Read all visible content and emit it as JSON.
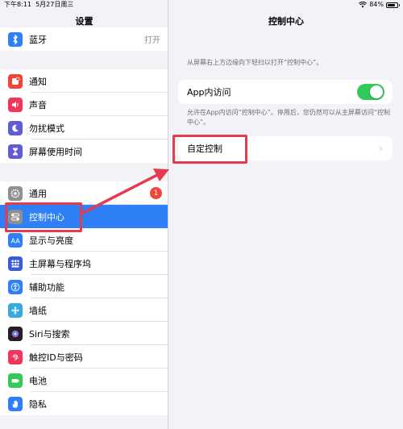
{
  "status": {
    "time": "下午8:11",
    "date": "5月27日周三",
    "battery": "84%",
    "battery_level": 0.84
  },
  "sidebar": {
    "title": "设置",
    "groups": [
      [
        {
          "label": "蓝牙",
          "value": "打开",
          "icon": "bluetooth-icon",
          "color": "#2f7ff6"
        }
      ],
      [
        {
          "label": "通知",
          "icon": "notification-icon",
          "color": "#f0463a"
        },
        {
          "label": "声音",
          "icon": "speaker-icon",
          "color": "#f0365a"
        },
        {
          "label": "勿扰模式",
          "icon": "moon-icon",
          "color": "#5f5cd6"
        },
        {
          "label": "屏幕使用时间",
          "icon": "hourglass-icon",
          "color": "#5f5cd6"
        }
      ],
      [
        {
          "label": "通用",
          "badge": "1",
          "icon": "gear-icon",
          "color": "#8e8e93"
        },
        {
          "label": "控制中心",
          "icon": "switches-icon",
          "color": "#8e8e93",
          "selected": true
        },
        {
          "label": "显示与亮度",
          "icon": "display-icon",
          "color": "#2f7ff6"
        },
        {
          "label": "主屏幕与程序坞",
          "icon": "grid-icon",
          "color": "#3a5bd9"
        },
        {
          "label": "辅助功能",
          "icon": "accessibility-icon",
          "color": "#2f7ff6"
        },
        {
          "label": "墙纸",
          "icon": "wallpaper-icon",
          "color": "#37aadc"
        },
        {
          "label": "Siri与搜索",
          "icon": "siri-icon",
          "color": "#222222"
        },
        {
          "label": "触控ID与密码",
          "icon": "fingerprint-icon",
          "color": "#f0365a"
        },
        {
          "label": "电池",
          "icon": "battery-icon",
          "color": "#34c759"
        },
        {
          "label": "隐私",
          "icon": "hand-icon",
          "color": "#2f7ff6"
        }
      ]
    ]
  },
  "detail": {
    "title": "控制中心",
    "hint": "从屏幕右上方边缘向下轻扫以打开“控制中心”。",
    "app_access": {
      "label": "App内访问",
      "on": true
    },
    "app_access_hint": "允许在App内访问“控制中心”。停用后，您仍然可以从主屏幕访问“控制中心”。",
    "customize": {
      "label": "自定控制"
    }
  },
  "colors": {
    "accent": "#2f7ff6",
    "toggle_on": "#34c759",
    "annotation": "#e43b50"
  }
}
